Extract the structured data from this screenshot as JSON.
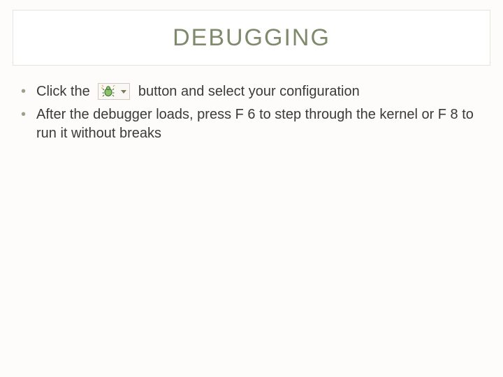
{
  "title": "DEBUGGING",
  "bullets": [
    {
      "pre": "Click the",
      "post": "button and select your configuration",
      "hasIcon": true
    },
    {
      "text": "After the debugger loads, press F 6 to step through the kernel or F 8 to run it without breaks"
    }
  ],
  "icon": {
    "name": "debug-icon"
  }
}
